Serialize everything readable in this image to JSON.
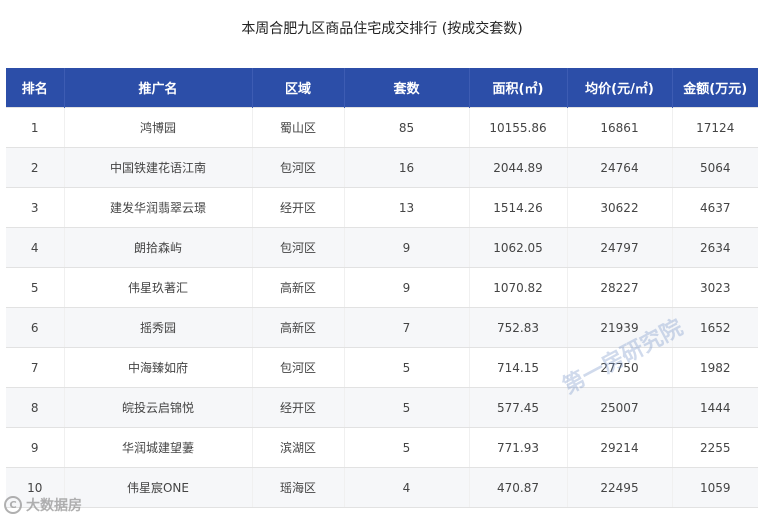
{
  "title": "本周合肥九区商品住宅成交排行 (按成交套数)",
  "table": {
    "columns": [
      "排名",
      "推广名",
      "区域",
      "套数",
      "面积(㎡)",
      "均价(元/㎡)",
      "金额(万元)"
    ],
    "rows": [
      [
        "1",
        "鸿博园",
        "蜀山区",
        "85",
        "10155.86",
        "16861",
        "17124"
      ],
      [
        "2",
        "中国铁建花语江南",
        "包河区",
        "16",
        "2044.89",
        "24764",
        "5064"
      ],
      [
        "3",
        "建发华润翡翠云璟",
        "经开区",
        "13",
        "1514.26",
        "30622",
        "4637"
      ],
      [
        "4",
        "朗拾森屿",
        "包河区",
        "9",
        "1062.05",
        "24797",
        "2634"
      ],
      [
        "5",
        "伟星玖著汇",
        "高新区",
        "9",
        "1070.82",
        "28227",
        "3023"
      ],
      [
        "6",
        "摇秀园",
        "高新区",
        "7",
        "752.83",
        "21939",
        "1652"
      ],
      [
        "7",
        "中海臻如府",
        "包河区",
        "5",
        "714.15",
        "27750",
        "1982"
      ],
      [
        "8",
        "皖投云启锦悦",
        "经开区",
        "5",
        "577.45",
        "25007",
        "1444"
      ],
      [
        "9",
        "华润城建望萋",
        "滨湖区",
        "5",
        "771.93",
        "29214",
        "2255"
      ],
      [
        "10",
        "伟星宸ONE",
        "瑶海区",
        "4",
        "470.87",
        "22495",
        "1059"
      ]
    ]
  },
  "watermark": "第一房研究院",
  "source_logo": {
    "mark": "C",
    "text": "大数据房"
  }
}
